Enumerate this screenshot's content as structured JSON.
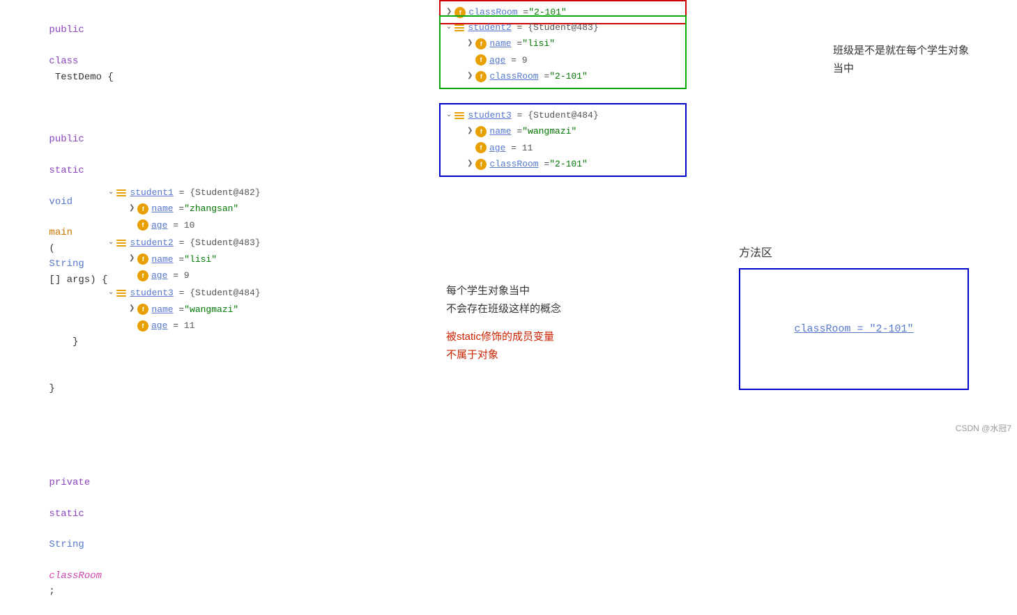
{
  "code": {
    "line1": "public class TestDemo {",
    "line2": "    public static void main(String[] args) {",
    "line3": "",
    "line4": "    }",
    "line5": "}",
    "line6": "",
    "line7": "    private static String classRoom;"
  },
  "debug_left": {
    "student1_label": "student1",
    "student1_value": "{Student@482}",
    "student1_name_value": "\"zhangsan\"",
    "student1_age_value": "10",
    "student2_label": "student2",
    "student2_value": "{Student@483}",
    "student2_name_value": "\"lisi\"",
    "student2_age_value": "9",
    "student3_label": "student3",
    "student3_value": "{Student@484}",
    "student3_name_value": "\"wangmazi\"",
    "student3_age_value": "11"
  },
  "debug_top": {
    "student2_label": "student2",
    "student2_value": "{Student@483}",
    "student2_name_value": "\"lisi\"",
    "student2_age_value": "9",
    "student2_classroom_value": "\"2-101\"",
    "student3_label": "student3",
    "student3_value": "{Student@484}",
    "student3_name_value": "\"wangmazi\"",
    "student3_age_value": "11",
    "student3_classroom_value": "\"2-101\"",
    "classroom_top_value": "classRoom = \"2-101\""
  },
  "annotations": {
    "top_right": "班级是不是就在每个学生对象当中",
    "middle1": "每个学生对象当中",
    "middle2": "不会存在班级这样的概念",
    "middle3": "被static修饰的成员变量",
    "middle4": "不属于对象",
    "fangfa": "方法区",
    "classroom_fangfa": "classRoom = \"2-101\""
  },
  "watermark": "CSDN @水冠7"
}
